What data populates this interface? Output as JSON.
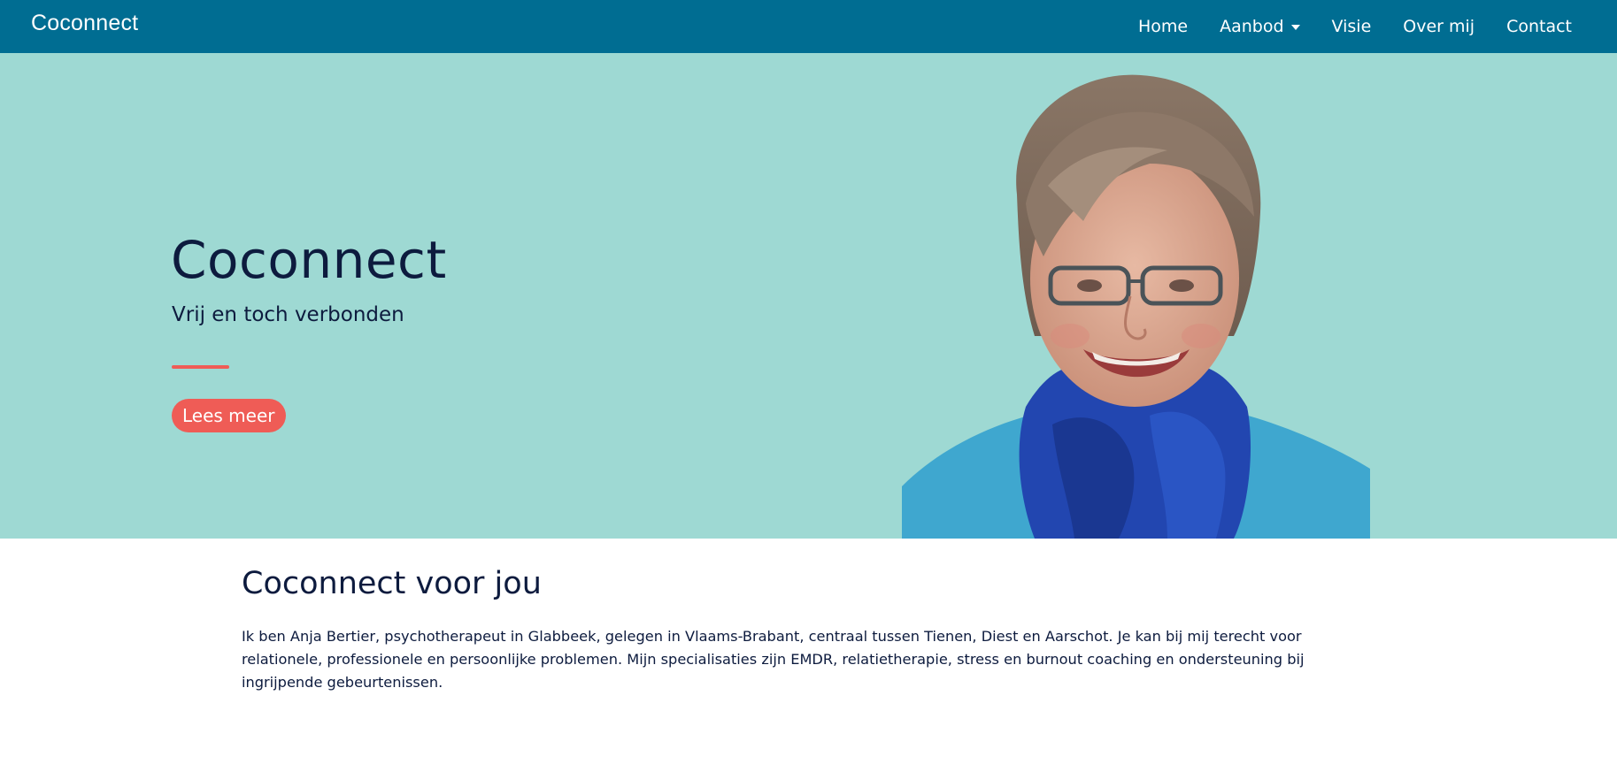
{
  "navbar": {
    "brand": "Coconnect",
    "links": [
      {
        "label": "Home"
      },
      {
        "label": "Aanbod"
      },
      {
        "label": "Visie"
      },
      {
        "label": "Over mij"
      },
      {
        "label": "Contact"
      }
    ]
  },
  "hero": {
    "title": "Coconnect",
    "subtitle": "Vrij en toch verbonden",
    "button_label": "Lees meer"
  },
  "intro": {
    "title": "Coconnect voor jou",
    "text": "Ik ben Anja Bertier, psychotherapeut in Glabbeek, gelegen in Vlaams-Brabant, centraal tussen Tienen, Diest en Aarschot. Je kan bij mij terecht voor relationele, professionele en persoonlijke problemen. Mijn specialisaties zijn EMDR, relatietherapie, stress en burnout coaching en ondersteuning bij ingrijpende gebeurtenissen."
  },
  "colors": {
    "navbar": "#006d92",
    "hero_background": "#9ed9d3",
    "accent": "#ef5c56",
    "text": "#0d1b3e"
  },
  "icons": {
    "dropdown": "caret-down-icon"
  }
}
